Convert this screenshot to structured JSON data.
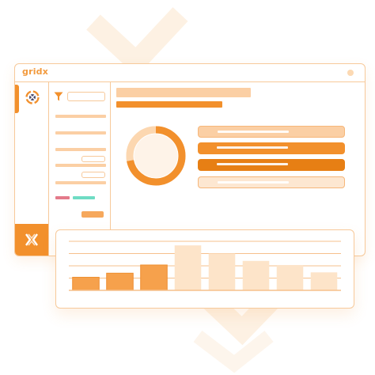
{
  "app": {
    "title": "gridx"
  },
  "icons": {
    "window_control": "window-dot-icon",
    "logo": "gridx-logo-icon",
    "rail_bottom": "gridx-mark-icon",
    "filter": "filter-funnel-icon"
  },
  "colors": {
    "accent": "#f2902c",
    "accent_dark": "#e77f14",
    "accent_light": "#fbcfa4",
    "border": "#f7c99a",
    "tag_red": "#e47a8a",
    "tag_teal": "#6fdcc4"
  },
  "donut": {
    "segments": [
      0.72,
      0.28
    ]
  },
  "chart_data": {
    "type": "bar",
    "categories": [
      "",
      "",
      "",
      "",
      "",
      "",
      "",
      ""
    ],
    "values": [
      16,
      21,
      31,
      55,
      45,
      36,
      31,
      22
    ],
    "highlighted": [
      true,
      true,
      true,
      false,
      false,
      false,
      false,
      false
    ],
    "ylim": [
      0,
      60
    ],
    "grid": true
  }
}
